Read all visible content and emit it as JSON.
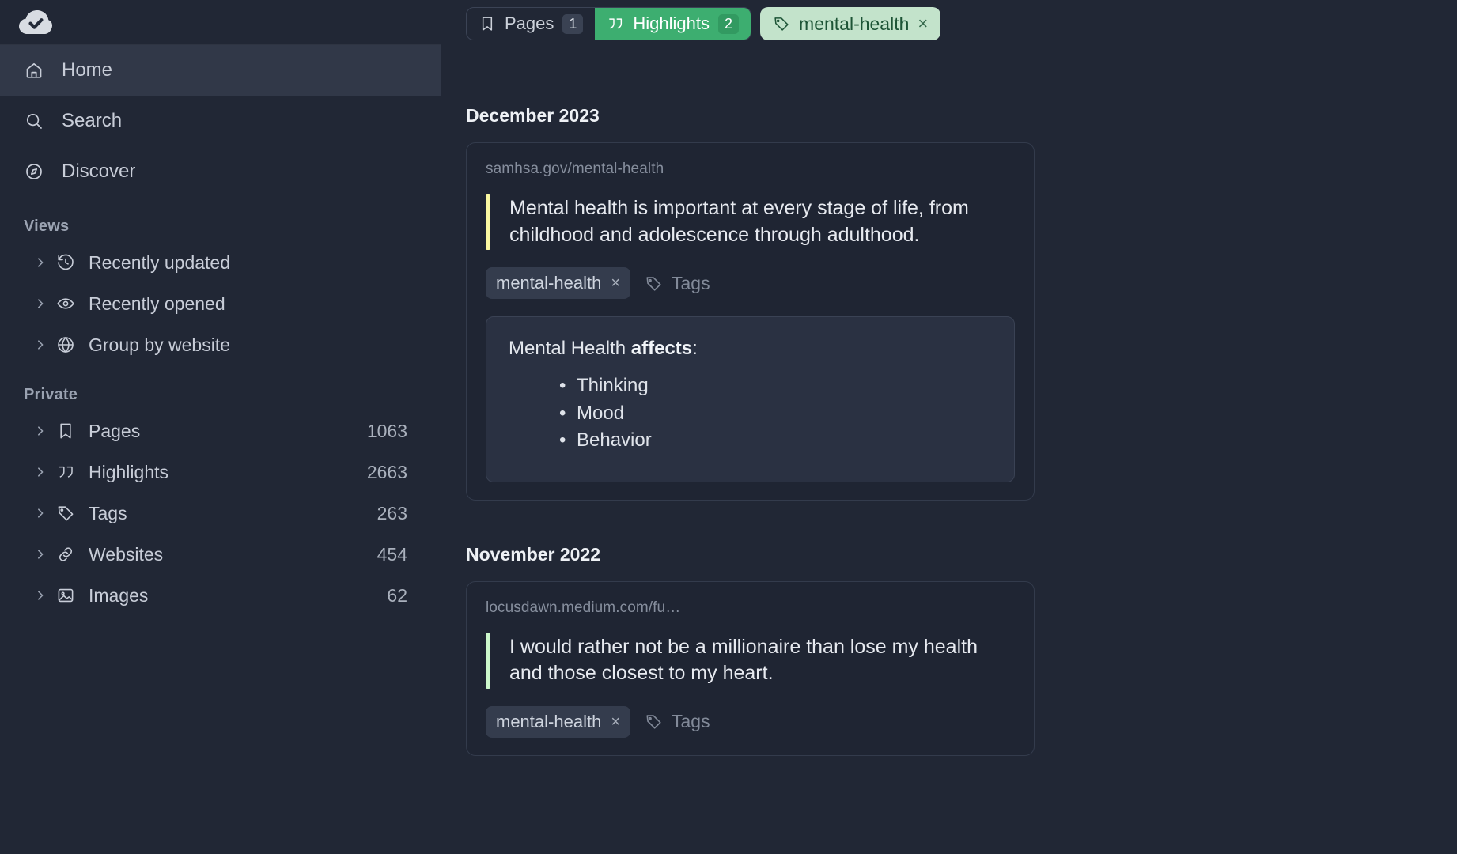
{
  "app": {
    "logo_icon": "cloud-check-icon",
    "background": "#212735",
    "accent_green": "#3dae70"
  },
  "sidebar": {
    "primary": [
      {
        "label": "Home",
        "icon": "home-icon",
        "active": true
      },
      {
        "label": "Search",
        "icon": "search-icon",
        "active": false
      },
      {
        "label": "Discover",
        "icon": "compass-icon",
        "active": false
      }
    ],
    "views": {
      "title": "Views",
      "items": [
        {
          "label": "Recently updated",
          "icon": "history-icon"
        },
        {
          "label": "Recently opened",
          "icon": "eye-icon"
        },
        {
          "label": "Group by website",
          "icon": "globe-icon"
        }
      ]
    },
    "private": {
      "title": "Private",
      "items": [
        {
          "label": "Pages",
          "icon": "bookmark-icon",
          "count": "1063"
        },
        {
          "label": "Highlights",
          "icon": "quote-icon",
          "count": "2663"
        },
        {
          "label": "Tags",
          "icon": "tag-icon",
          "count": "263"
        },
        {
          "label": "Websites",
          "icon": "link-icon",
          "count": "454"
        },
        {
          "label": "Images",
          "icon": "image-icon",
          "count": "62"
        }
      ]
    }
  },
  "main": {
    "tabs": [
      {
        "label": "Pages",
        "icon": "bookmark-icon",
        "badge": "1",
        "active": false
      },
      {
        "label": "Highlights",
        "icon": "quote-icon",
        "badge": "2",
        "active": true
      }
    ],
    "filter_chip": {
      "label": "mental-health",
      "icon": "tag-icon",
      "remove": "×",
      "bg": "#c3e3cb",
      "fg": "#1d5436"
    },
    "groups": [
      {
        "title": "December 2023",
        "cards": [
          {
            "url": "samhsa.gov/mental-health",
            "quote": "Mental health is important at every stage of life, from childhood and adolescence through adulthood.",
            "quote_color": "#faf7a1",
            "tags": [
              {
                "label": "mental-health",
                "remove": "×"
              }
            ],
            "add_tag_label": "Tags",
            "note": {
              "title_plain": "Mental Health ",
              "title_bold": "affects",
              "title_suffix": ":",
              "items": [
                "Thinking",
                "Mood",
                "Behavior"
              ]
            }
          }
        ]
      },
      {
        "title": "November 2022",
        "cards": [
          {
            "url": "locusdawn.medium.com/fu…",
            "quote": "I would rather not be a millionaire than lose my health and those closest to my heart.",
            "quote_color": "#ccf7cb",
            "tags": [
              {
                "label": "mental-health",
                "remove": "×"
              }
            ],
            "add_tag_label": "Tags",
            "note": null
          }
        ]
      }
    ]
  }
}
